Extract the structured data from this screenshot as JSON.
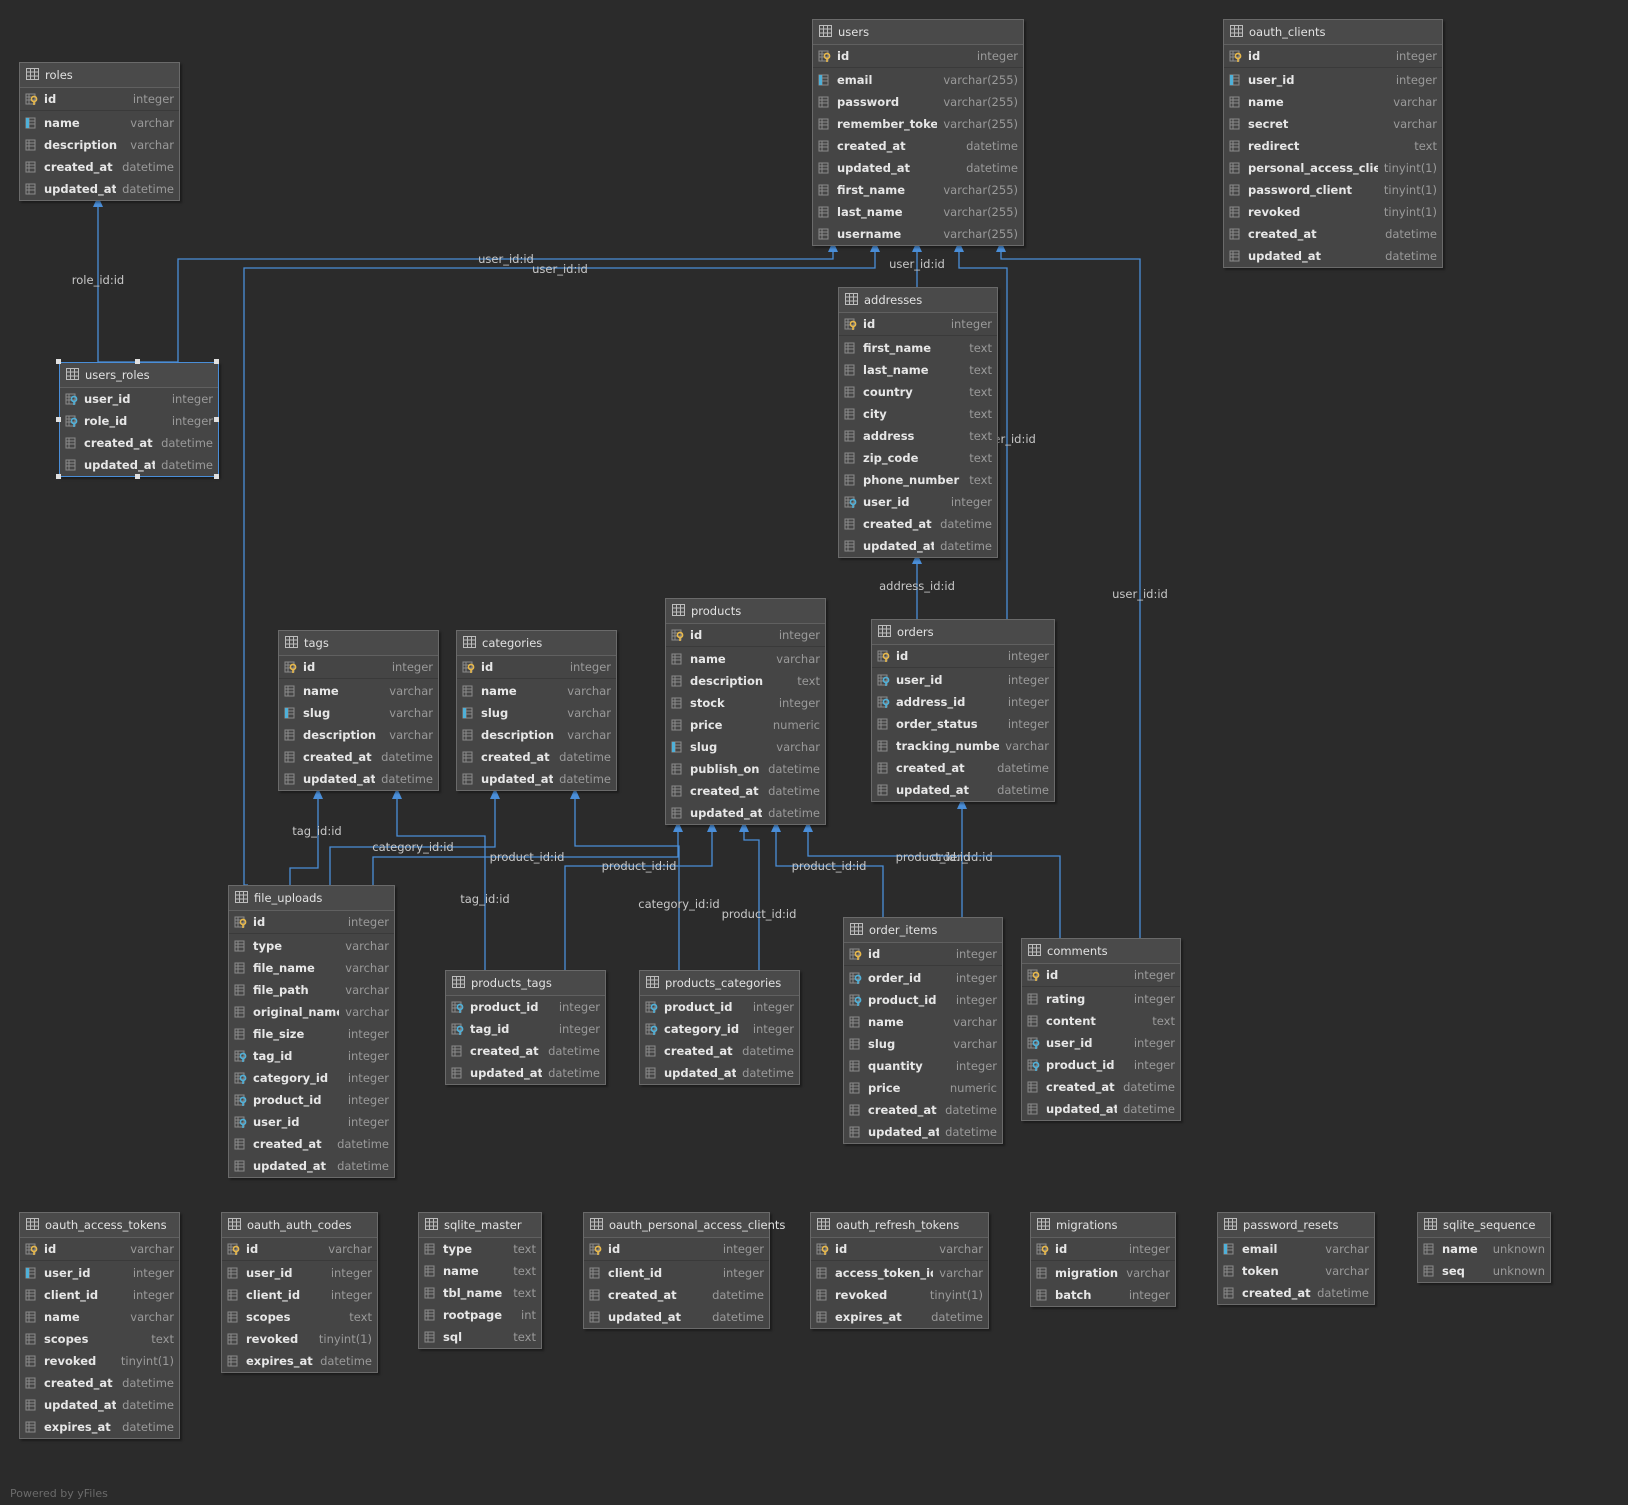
{
  "watermark": "Powered by yFiles",
  "tables": [
    {
      "id": "users",
      "name": "users",
      "columns": [
        {
          "name": "id",
          "type": "integer",
          "kind": "pk"
        },
        {
          "name": "email",
          "type": "varchar(255)",
          "kind": "idx"
        },
        {
          "name": "password",
          "type": "varchar(255)",
          "kind": "col"
        },
        {
          "name": "remember_token",
          "type": "varchar(255)",
          "kind": "col"
        },
        {
          "name": "created_at",
          "type": "datetime",
          "kind": "col"
        },
        {
          "name": "updated_at",
          "type": "datetime",
          "kind": "col"
        },
        {
          "name": "first_name",
          "type": "varchar(255)",
          "kind": "col"
        },
        {
          "name": "last_name",
          "type": "varchar(255)",
          "kind": "col"
        },
        {
          "name": "username",
          "type": "varchar(255)",
          "kind": "col"
        }
      ]
    },
    {
      "id": "oauth_clients",
      "name": "oauth_clients",
      "columns": [
        {
          "name": "id",
          "type": "integer",
          "kind": "pk"
        },
        {
          "name": "user_id",
          "type": "integer",
          "kind": "idx"
        },
        {
          "name": "name",
          "type": "varchar",
          "kind": "col"
        },
        {
          "name": "secret",
          "type": "varchar",
          "kind": "col"
        },
        {
          "name": "redirect",
          "type": "text",
          "kind": "col"
        },
        {
          "name": "personal_access_client",
          "type": "tinyint(1)",
          "kind": "col"
        },
        {
          "name": "password_client",
          "type": "tinyint(1)",
          "kind": "col"
        },
        {
          "name": "revoked",
          "type": "tinyint(1)",
          "kind": "col"
        },
        {
          "name": "created_at",
          "type": "datetime",
          "kind": "col"
        },
        {
          "name": "updated_at",
          "type": "datetime",
          "kind": "col"
        }
      ]
    },
    {
      "id": "roles",
      "name": "roles",
      "columns": [
        {
          "name": "id",
          "type": "integer",
          "kind": "pk"
        },
        {
          "name": "name",
          "type": "varchar",
          "kind": "idx"
        },
        {
          "name": "description",
          "type": "varchar",
          "kind": "col"
        },
        {
          "name": "created_at",
          "type": "datetime",
          "kind": "col"
        },
        {
          "name": "updated_at",
          "type": "datetime",
          "kind": "col"
        }
      ]
    },
    {
      "id": "users_roles",
      "name": "users_roles",
      "selected": true,
      "columns": [
        {
          "name": "user_id",
          "type": "integer",
          "kind": "fk"
        },
        {
          "name": "role_id",
          "type": "integer",
          "kind": "fk"
        },
        {
          "name": "created_at",
          "type": "datetime",
          "kind": "col"
        },
        {
          "name": "updated_at",
          "type": "datetime",
          "kind": "col"
        }
      ]
    },
    {
      "id": "addresses",
      "name": "addresses",
      "columns": [
        {
          "name": "id",
          "type": "integer",
          "kind": "pk"
        },
        {
          "name": "first_name",
          "type": "text",
          "kind": "col"
        },
        {
          "name": "last_name",
          "type": "text",
          "kind": "col"
        },
        {
          "name": "country",
          "type": "text",
          "kind": "col"
        },
        {
          "name": "city",
          "type": "text",
          "kind": "col"
        },
        {
          "name": "address",
          "type": "text",
          "kind": "col"
        },
        {
          "name": "zip_code",
          "type": "text",
          "kind": "col"
        },
        {
          "name": "phone_number",
          "type": "text",
          "kind": "col"
        },
        {
          "name": "user_id",
          "type": "integer",
          "kind": "fk"
        },
        {
          "name": "created_at",
          "type": "datetime",
          "kind": "col"
        },
        {
          "name": "updated_at",
          "type": "datetime",
          "kind": "col"
        }
      ]
    },
    {
      "id": "products",
      "name": "products",
      "columns": [
        {
          "name": "id",
          "type": "integer",
          "kind": "pk"
        },
        {
          "name": "name",
          "type": "varchar",
          "kind": "col"
        },
        {
          "name": "description",
          "type": "text",
          "kind": "col"
        },
        {
          "name": "stock",
          "type": "integer",
          "kind": "col"
        },
        {
          "name": "price",
          "type": "numeric",
          "kind": "col"
        },
        {
          "name": "slug",
          "type": "varchar",
          "kind": "idx"
        },
        {
          "name": "publish_on",
          "type": "datetime",
          "kind": "col"
        },
        {
          "name": "created_at",
          "type": "datetime",
          "kind": "col"
        },
        {
          "name": "updated_at",
          "type": "datetime",
          "kind": "col"
        }
      ]
    },
    {
      "id": "orders",
      "name": "orders",
      "columns": [
        {
          "name": "id",
          "type": "integer",
          "kind": "pk"
        },
        {
          "name": "user_id",
          "type": "integer",
          "kind": "fk"
        },
        {
          "name": "address_id",
          "type": "integer",
          "kind": "fk"
        },
        {
          "name": "order_status",
          "type": "integer",
          "kind": "col"
        },
        {
          "name": "tracking_number",
          "type": "varchar",
          "kind": "col"
        },
        {
          "name": "created_at",
          "type": "datetime",
          "kind": "col"
        },
        {
          "name": "updated_at",
          "type": "datetime",
          "kind": "col"
        }
      ]
    },
    {
      "id": "tags",
      "name": "tags",
      "columns": [
        {
          "name": "id",
          "type": "integer",
          "kind": "pk"
        },
        {
          "name": "name",
          "type": "varchar",
          "kind": "col"
        },
        {
          "name": "slug",
          "type": "varchar",
          "kind": "idx"
        },
        {
          "name": "description",
          "type": "varchar",
          "kind": "col"
        },
        {
          "name": "created_at",
          "type": "datetime",
          "kind": "col"
        },
        {
          "name": "updated_at",
          "type": "datetime",
          "kind": "col"
        }
      ]
    },
    {
      "id": "categories",
      "name": "categories",
      "columns": [
        {
          "name": "id",
          "type": "integer",
          "kind": "pk"
        },
        {
          "name": "name",
          "type": "varchar",
          "kind": "col"
        },
        {
          "name": "slug",
          "type": "varchar",
          "kind": "idx"
        },
        {
          "name": "description",
          "type": "varchar",
          "kind": "col"
        },
        {
          "name": "created_at",
          "type": "datetime",
          "kind": "col"
        },
        {
          "name": "updated_at",
          "type": "datetime",
          "kind": "col"
        }
      ]
    },
    {
      "id": "file_uploads",
      "name": "file_uploads",
      "columns": [
        {
          "name": "id",
          "type": "integer",
          "kind": "pk"
        },
        {
          "name": "type",
          "type": "varchar",
          "kind": "col"
        },
        {
          "name": "file_name",
          "type": "varchar",
          "kind": "col"
        },
        {
          "name": "file_path",
          "type": "varchar",
          "kind": "col"
        },
        {
          "name": "original_name",
          "type": "varchar",
          "kind": "col"
        },
        {
          "name": "file_size",
          "type": "integer",
          "kind": "col"
        },
        {
          "name": "tag_id",
          "type": "integer",
          "kind": "fk"
        },
        {
          "name": "category_id",
          "type": "integer",
          "kind": "fk"
        },
        {
          "name": "product_id",
          "type": "integer",
          "kind": "fk"
        },
        {
          "name": "user_id",
          "type": "integer",
          "kind": "fk"
        },
        {
          "name": "created_at",
          "type": "datetime",
          "kind": "col"
        },
        {
          "name": "updated_at",
          "type": "datetime",
          "kind": "col"
        }
      ]
    },
    {
      "id": "products_tags",
      "name": "products_tags",
      "columns": [
        {
          "name": "product_id",
          "type": "integer",
          "kind": "fk"
        },
        {
          "name": "tag_id",
          "type": "integer",
          "kind": "fk"
        },
        {
          "name": "created_at",
          "type": "datetime",
          "kind": "col"
        },
        {
          "name": "updated_at",
          "type": "datetime",
          "kind": "col"
        }
      ]
    },
    {
      "id": "products_categories",
      "name": "products_categories",
      "columns": [
        {
          "name": "product_id",
          "type": "integer",
          "kind": "fk"
        },
        {
          "name": "category_id",
          "type": "integer",
          "kind": "fk"
        },
        {
          "name": "created_at",
          "type": "datetime",
          "kind": "col"
        },
        {
          "name": "updated_at",
          "type": "datetime",
          "kind": "col"
        }
      ]
    },
    {
      "id": "order_items",
      "name": "order_items",
      "columns": [
        {
          "name": "id",
          "type": "integer",
          "kind": "pk"
        },
        {
          "name": "order_id",
          "type": "integer",
          "kind": "fk"
        },
        {
          "name": "product_id",
          "type": "integer",
          "kind": "fk"
        },
        {
          "name": "name",
          "type": "varchar",
          "kind": "col"
        },
        {
          "name": "slug",
          "type": "varchar",
          "kind": "col"
        },
        {
          "name": "quantity",
          "type": "integer",
          "kind": "col"
        },
        {
          "name": "price",
          "type": "numeric",
          "kind": "col"
        },
        {
          "name": "created_at",
          "type": "datetime",
          "kind": "col"
        },
        {
          "name": "updated_at",
          "type": "datetime",
          "kind": "col"
        }
      ]
    },
    {
      "id": "comments",
      "name": "comments",
      "columns": [
        {
          "name": "id",
          "type": "integer",
          "kind": "pk"
        },
        {
          "name": "rating",
          "type": "integer",
          "kind": "col"
        },
        {
          "name": "content",
          "type": "text",
          "kind": "col"
        },
        {
          "name": "user_id",
          "type": "integer",
          "kind": "fk"
        },
        {
          "name": "product_id",
          "type": "integer",
          "kind": "fk"
        },
        {
          "name": "created_at",
          "type": "datetime",
          "kind": "col"
        },
        {
          "name": "updated_at",
          "type": "datetime",
          "kind": "col"
        }
      ]
    },
    {
      "id": "oauth_access_tokens",
      "name": "oauth_access_tokens",
      "columns": [
        {
          "name": "id",
          "type": "varchar",
          "kind": "pk"
        },
        {
          "name": "user_id",
          "type": "integer",
          "kind": "idx"
        },
        {
          "name": "client_id",
          "type": "integer",
          "kind": "col"
        },
        {
          "name": "name",
          "type": "varchar",
          "kind": "col"
        },
        {
          "name": "scopes",
          "type": "text",
          "kind": "col"
        },
        {
          "name": "revoked",
          "type": "tinyint(1)",
          "kind": "col"
        },
        {
          "name": "created_at",
          "type": "datetime",
          "kind": "col"
        },
        {
          "name": "updated_at",
          "type": "datetime",
          "kind": "col"
        },
        {
          "name": "expires_at",
          "type": "datetime",
          "kind": "col"
        }
      ]
    },
    {
      "id": "oauth_auth_codes",
      "name": "oauth_auth_codes",
      "columns": [
        {
          "name": "id",
          "type": "varchar",
          "kind": "pk"
        },
        {
          "name": "user_id",
          "type": "integer",
          "kind": "col"
        },
        {
          "name": "client_id",
          "type": "integer",
          "kind": "col"
        },
        {
          "name": "scopes",
          "type": "text",
          "kind": "col"
        },
        {
          "name": "revoked",
          "type": "tinyint(1)",
          "kind": "col"
        },
        {
          "name": "expires_at",
          "type": "datetime",
          "kind": "col"
        }
      ]
    },
    {
      "id": "sqlite_master",
      "name": "sqlite_master",
      "columns": [
        {
          "name": "type",
          "type": "text",
          "kind": "col"
        },
        {
          "name": "name",
          "type": "text",
          "kind": "col"
        },
        {
          "name": "tbl_name",
          "type": "text",
          "kind": "col"
        },
        {
          "name": "rootpage",
          "type": "int",
          "kind": "col"
        },
        {
          "name": "sql",
          "type": "text",
          "kind": "col"
        }
      ]
    },
    {
      "id": "oauth_personal_access_clients",
      "name": "oauth_personal_access_clients",
      "columns": [
        {
          "name": "id",
          "type": "integer",
          "kind": "pk"
        },
        {
          "name": "client_id",
          "type": "integer",
          "kind": "col"
        },
        {
          "name": "created_at",
          "type": "datetime",
          "kind": "col"
        },
        {
          "name": "updated_at",
          "type": "datetime",
          "kind": "col"
        }
      ]
    },
    {
      "id": "oauth_refresh_tokens",
      "name": "oauth_refresh_tokens",
      "columns": [
        {
          "name": "id",
          "type": "varchar",
          "kind": "pk"
        },
        {
          "name": "access_token_id",
          "type": "varchar",
          "kind": "col"
        },
        {
          "name": "revoked",
          "type": "tinyint(1)",
          "kind": "col"
        },
        {
          "name": "expires_at",
          "type": "datetime",
          "kind": "col"
        }
      ]
    },
    {
      "id": "migrations",
      "name": "migrations",
      "columns": [
        {
          "name": "id",
          "type": "integer",
          "kind": "pk"
        },
        {
          "name": "migration",
          "type": "varchar",
          "kind": "col"
        },
        {
          "name": "batch",
          "type": "integer",
          "kind": "col"
        }
      ]
    },
    {
      "id": "password_resets",
      "name": "password_resets",
      "columns": [
        {
          "name": "email",
          "type": "varchar",
          "kind": "idx"
        },
        {
          "name": "token",
          "type": "varchar",
          "kind": "col"
        },
        {
          "name": "created_at",
          "type": "datetime",
          "kind": "col"
        }
      ]
    },
    {
      "id": "sqlite_sequence",
      "name": "sqlite_sequence",
      "columns": [
        {
          "name": "name",
          "type": "unknown",
          "kind": "col"
        },
        {
          "name": "seq",
          "type": "unknown",
          "kind": "col"
        }
      ]
    }
  ],
  "relations": [
    {
      "id": "users_roles-roles",
      "label": "role_id:id"
    },
    {
      "id": "users_roles-users",
      "label": "user_id:id"
    },
    {
      "id": "file_uploads-users",
      "label": "user_id:id"
    },
    {
      "id": "addresses-users",
      "label": "user_id:id"
    },
    {
      "id": "orders-users",
      "label": "user_id:id"
    },
    {
      "id": "comments-users",
      "label": "user_id:id"
    },
    {
      "id": "orders-addresses",
      "label": "address_id:id"
    },
    {
      "id": "file_uploads-tags",
      "label": "tag_id:id"
    },
    {
      "id": "file_uploads-categories",
      "label": "category_id:id"
    },
    {
      "id": "file_uploads-products",
      "label": "product_id:id"
    },
    {
      "id": "products_tags-tags",
      "label": "tag_id:id"
    },
    {
      "id": "products_tags-products",
      "label": "product_id:id"
    },
    {
      "id": "products_categories-categories",
      "label": "category_id:id"
    },
    {
      "id": "products_categories-products",
      "label": "product_id:id"
    },
    {
      "id": "order_items-products",
      "label": "product_id:id"
    },
    {
      "id": "order_items-orders",
      "label": "order_id:id"
    },
    {
      "id": "comments-products",
      "label": "product_id:id"
    }
  ],
  "colors": {
    "background": "#2b2b2b",
    "edge": "#4a8ed8",
    "table": "#454545",
    "key": "#e8b84a",
    "index": "#4fb0d8"
  }
}
